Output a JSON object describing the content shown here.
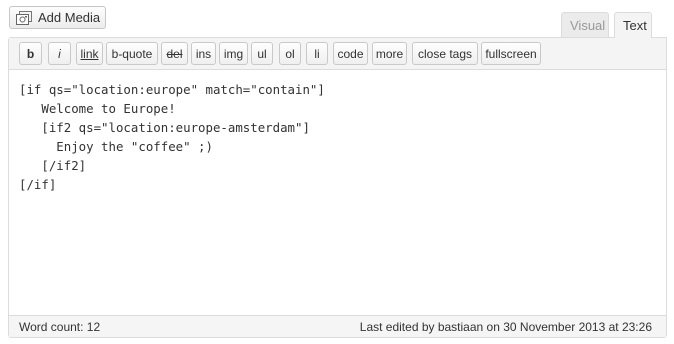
{
  "media": {
    "label": "Add Media",
    "icon": "media-icon"
  },
  "tabs": [
    {
      "label": "Visual",
      "active": false
    },
    {
      "label": "Text",
      "active": true
    }
  ],
  "toolbar": {
    "buttons": [
      "b",
      "i",
      "link",
      "b-quote",
      "del",
      "ins",
      "img",
      "ul",
      "ol",
      "li",
      "code",
      "more",
      "close tags",
      "fullscreen"
    ]
  },
  "content": {
    "text": "[if qs=\"location:europe\" match=\"contain\"]\n   Welcome to Europe!\n   [if2 qs=\"location:europe-amsterdam\"]\n     Enjoy the \"coffee\" ;)\n   [/if2]\n[/if]"
  },
  "status": {
    "word_count": "Word count: 12",
    "last_edited": "Last edited by bastiaan on 30 November 2013 at 23:26"
  }
}
